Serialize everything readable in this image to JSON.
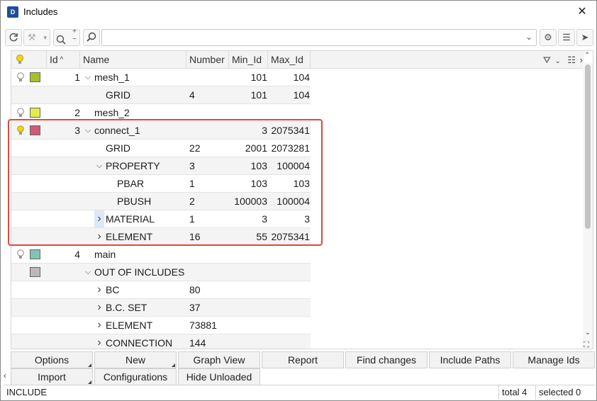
{
  "window": {
    "title": "Includes",
    "app_icon_label": "D"
  },
  "toolbar": {
    "search_value": "",
    "search_placeholder": ""
  },
  "columns": [
    "Id",
    "Name",
    "Number",
    "Min_Id",
    "Max_Id"
  ],
  "rows": [
    {
      "id": "1",
      "name": "mesh_1",
      "number": "",
      "min_id": "101",
      "max_id": "104",
      "bulb": "off",
      "swatch": "#a9c02a",
      "expander": "expanded",
      "level": 0
    },
    {
      "id": "",
      "name": "GRID",
      "number": "4",
      "min_id": "101",
      "max_id": "104",
      "level": 1
    },
    {
      "id": "2",
      "name": "mesh_2",
      "number": "",
      "min_id": "",
      "max_id": "",
      "bulb": "off",
      "swatch": "#e3ee4c",
      "expander": "none",
      "level": 0
    },
    {
      "id": "3",
      "name": "connect_1",
      "number": "",
      "min_id": "3",
      "max_id": "2075341",
      "bulb": "on",
      "swatch": "#d4577a",
      "expander": "expanded",
      "level": 0
    },
    {
      "id": "",
      "name": "GRID",
      "number": "22",
      "min_id": "2001",
      "max_id": "2073281",
      "level": 1
    },
    {
      "id": "",
      "name": "PROPERTY",
      "number": "3",
      "min_id": "103",
      "max_id": "100004",
      "expander": "expanded",
      "level": 1
    },
    {
      "id": "",
      "name": "PBAR",
      "number": "1",
      "min_id": "103",
      "max_id": "103",
      "level": 2
    },
    {
      "id": "",
      "name": "PBUSH",
      "number": "2",
      "min_id": "100003",
      "max_id": "100004",
      "level": 2
    },
    {
      "id": "",
      "name": "MATERIAL",
      "number": "1",
      "min_id": "3",
      "max_id": "3",
      "expander": "collapsed",
      "level": 1
    },
    {
      "id": "",
      "name": "ELEMENT",
      "number": "16",
      "min_id": "55",
      "max_id": "2075341",
      "expander": "collapsed",
      "level": 1
    },
    {
      "id": "4",
      "name": "main",
      "number": "",
      "min_id": "",
      "max_id": "",
      "bulb": "off",
      "swatch": "#7fc4b3",
      "expander": "none",
      "level": 0
    },
    {
      "id": "",
      "name": "OUT OF INCLUDES",
      "number": "",
      "min_id": "",
      "max_id": "",
      "swatch": "#b9b9b9",
      "expander": "expanded",
      "level": 0
    },
    {
      "id": "",
      "name": "BC",
      "number": "80",
      "min_id": "",
      "max_id": "",
      "expander": "collapsed",
      "level": 1
    },
    {
      "id": "",
      "name": "B.C. SET",
      "number": "37",
      "min_id": "",
      "max_id": "",
      "expander": "collapsed",
      "level": 1
    },
    {
      "id": "",
      "name": "ELEMENT",
      "number": "73881",
      "min_id": "",
      "max_id": "",
      "expander": "collapsed",
      "level": 1
    },
    {
      "id": "",
      "name": "CONNECTION",
      "number": "144",
      "min_id": "",
      "max_id": "",
      "expander": "collapsed",
      "level": 1
    }
  ],
  "buttons_row1": [
    {
      "label": "Options",
      "corner": true
    },
    {
      "label": "New",
      "corner": true
    },
    {
      "label": "Graph View",
      "corner": false
    },
    {
      "label": "Report",
      "corner": false
    },
    {
      "label": "Find changes",
      "corner": false
    },
    {
      "label": "Include Paths",
      "corner": false
    },
    {
      "label": "Manage Ids",
      "corner": false
    }
  ],
  "buttons_row2": [
    {
      "label": "Import",
      "corner": true
    },
    {
      "label": "Configurations",
      "corner": false
    },
    {
      "label": "Hide Unloaded",
      "corner": false
    }
  ],
  "status": {
    "left": "INCLUDE",
    "total": "total 4",
    "selected": "selected 0"
  },
  "colors": {
    "highlight": "#e0483c",
    "bulb_on": "#f2d31b"
  }
}
